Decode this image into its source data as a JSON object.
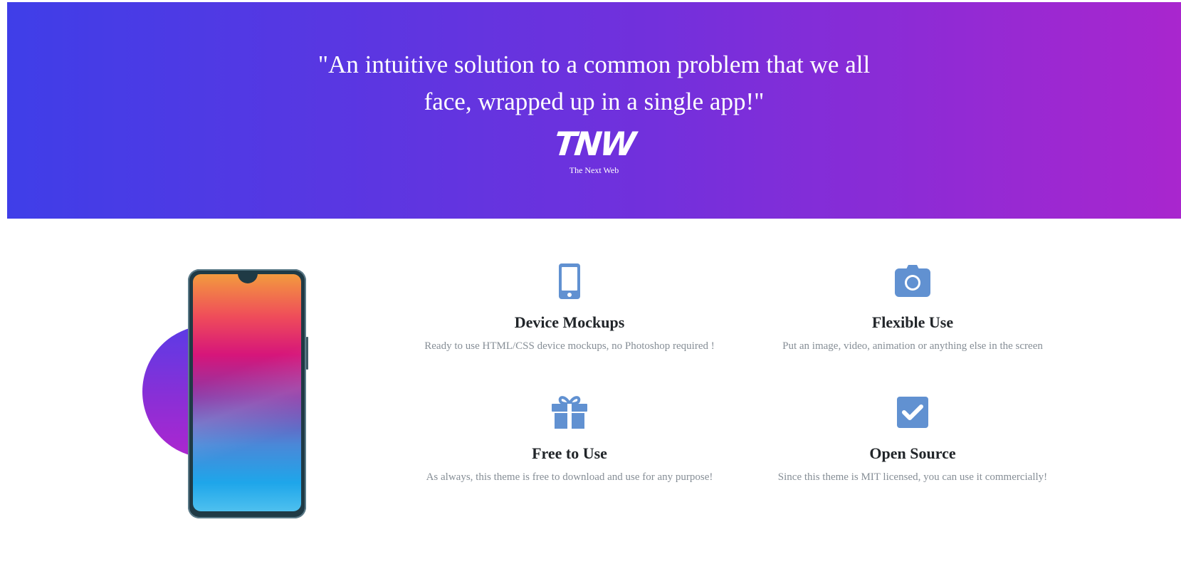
{
  "testimonial": {
    "quote_line1": "\"An intuitive solution to a common problem that we all",
    "quote_line2": "face, wrapped up in a single app!\"",
    "logo_text": "TNW",
    "caption": "The Next Web"
  },
  "colors": {
    "gradient_start": "#3f3ee8",
    "gradient_end": "#a926ce",
    "icon_color": "#6191d1",
    "heading_color": "#212529",
    "text_muted": "#868e96"
  },
  "features": [
    {
      "icon": "mobile-phone-icon",
      "title": "Device Mockups",
      "description": "Ready to use HTML/CSS device mockups, no Photoshop required !"
    },
    {
      "icon": "camera-icon",
      "title": "Flexible Use",
      "description": "Put an image, video, animation or anything else in the screen"
    },
    {
      "icon": "gift-icon",
      "title": "Free to Use",
      "description": "As always, this theme is free to download and use for any purpose!"
    },
    {
      "icon": "check-square-icon",
      "title": "Open Source",
      "description": "Since this theme is MIT licensed, you can use it commercially!"
    }
  ]
}
